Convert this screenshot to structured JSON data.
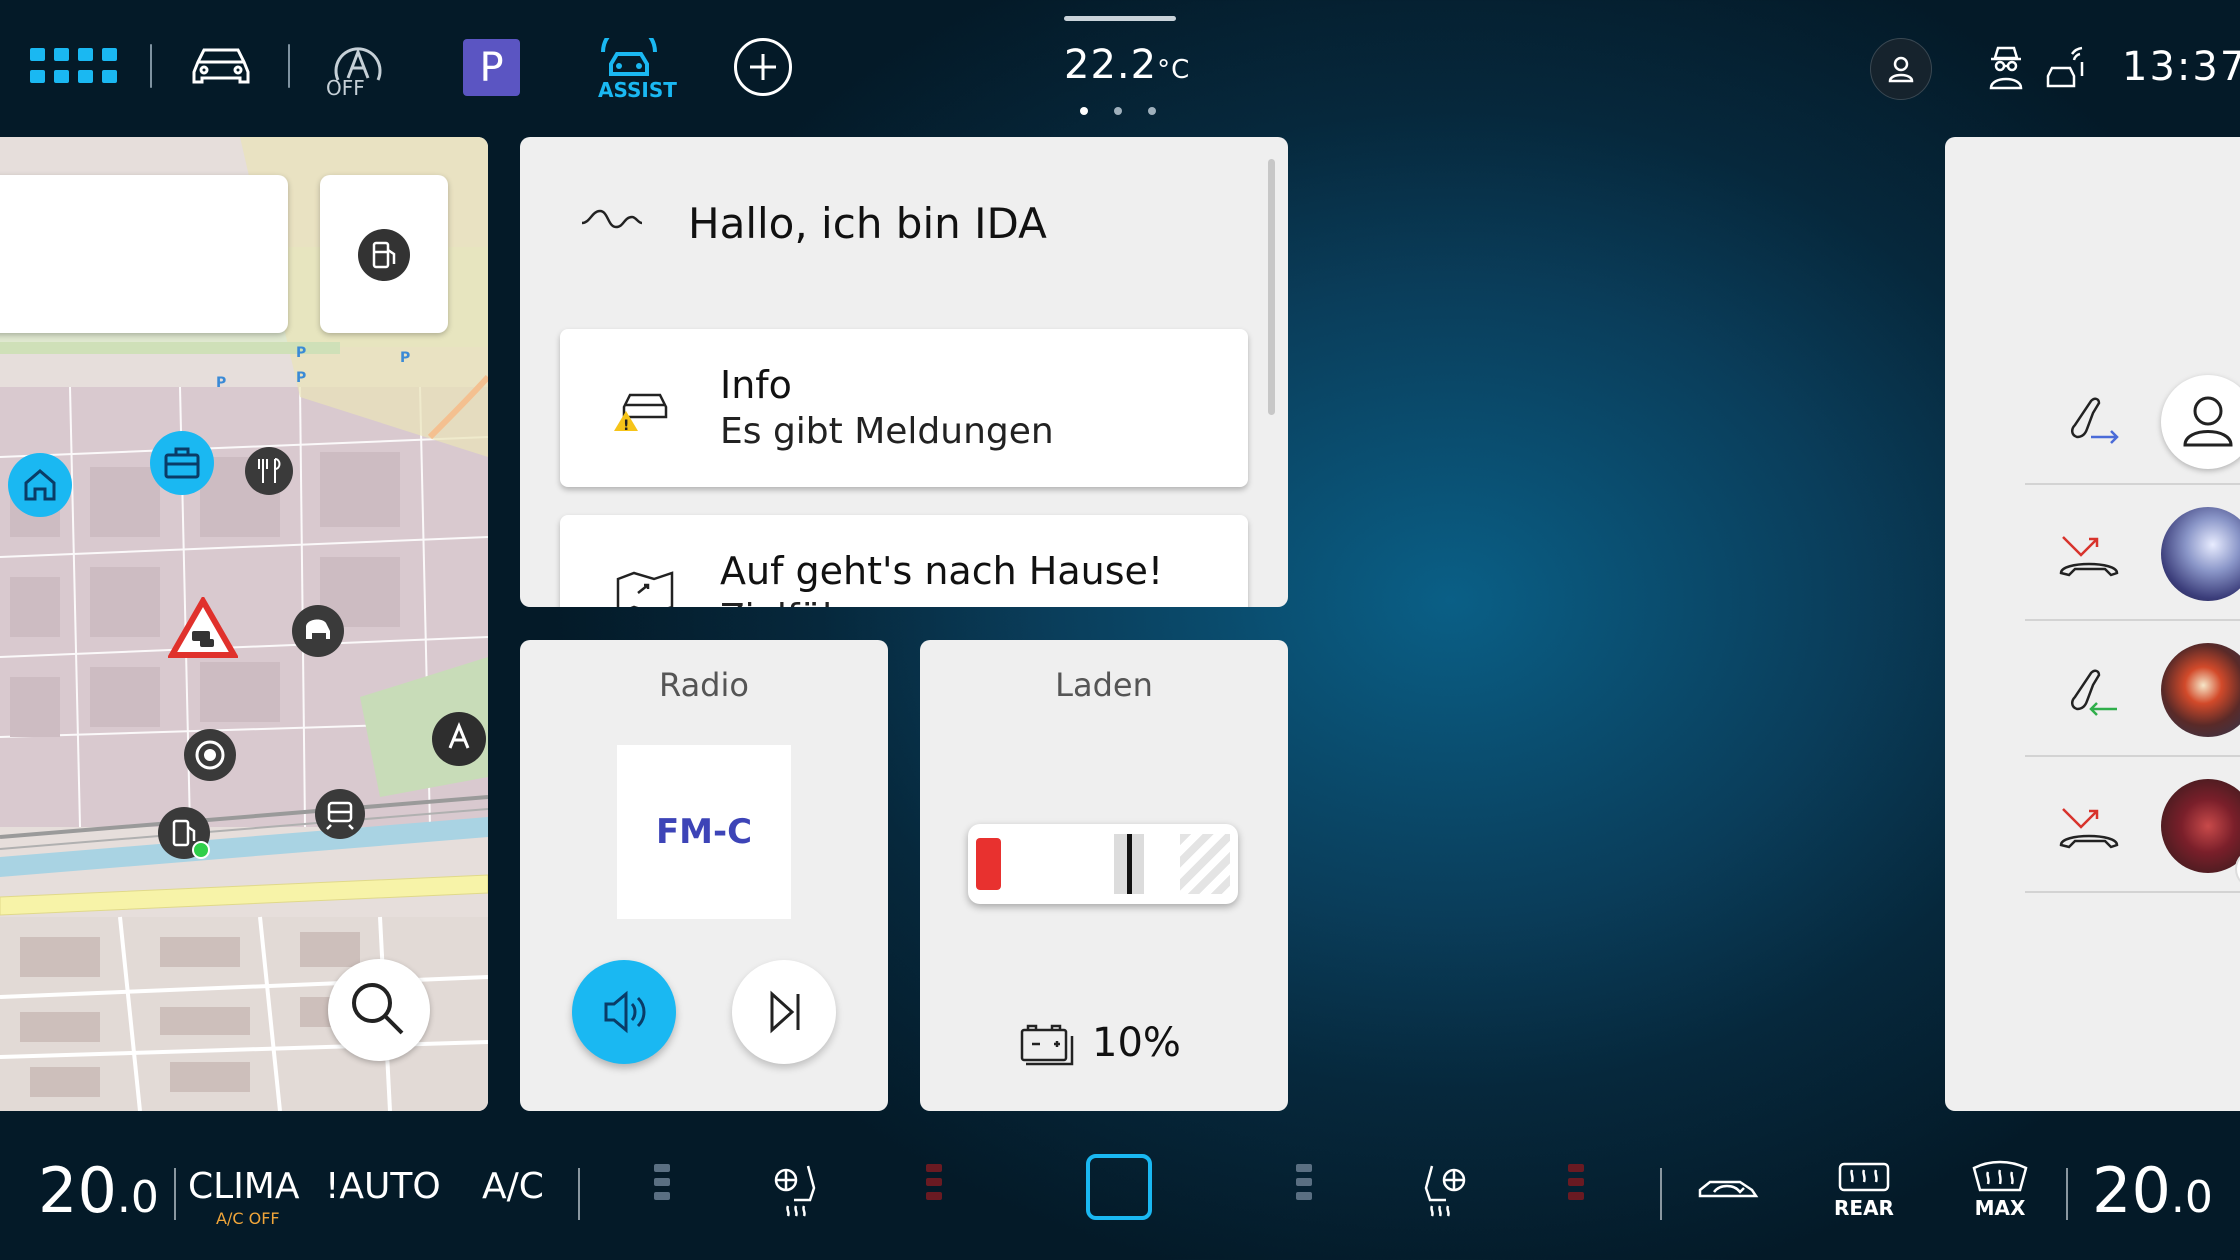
{
  "top_bar": {
    "assist_off_label": "OFF",
    "park_label": "P",
    "assist_label": "ASSIST",
    "temperature_value": "22.2",
    "temperature_unit": "°C",
    "page_count": 3,
    "active_page": 1,
    "clock": "13:37"
  },
  "ida": {
    "title": "Hallo, ich bin IDA",
    "items": [
      {
        "title": "Info",
        "subtitle": "Es gibt Meldungen",
        "icon": "car-warning-icon"
      },
      {
        "title": "Auf geht's nach Hause!",
        "subtitle": "Zielführung",
        "icon": "route-map-icon"
      }
    ]
  },
  "radio": {
    "title": "Radio",
    "station": "FM-C"
  },
  "charging": {
    "title": "Laden",
    "battery_percent": "10%",
    "battery_level": 0.1
  },
  "calls": {
    "entries": [
      {
        "type": "outgoing",
        "icon": "outgoing-call-icon",
        "contact": "no-photo"
      },
      {
        "type": "missed",
        "icon": "missed-call-icon",
        "contact": "photo"
      },
      {
        "type": "incoming",
        "icon": "incoming-call-icon",
        "contact": "photo"
      },
      {
        "type": "missed",
        "icon": "missed-call-icon",
        "contact": "photo"
      }
    ]
  },
  "climate": {
    "left_temp_main": "20",
    "left_temp_decimal": ".0",
    "clima_label": "CLIMA",
    "ac_off_label": "A/C OFF",
    "auto_label": "!AUTO",
    "ac_label": "A/C",
    "rear_label": "REAR",
    "max_label": "MAX",
    "right_temp_main": "20",
    "right_temp_decimal": ".0"
  },
  "colors": {
    "accent_blue": "#1ab8f2",
    "park_purple": "#5b55c2",
    "battery_red": "#e8312f",
    "missed_red": "#d8332c",
    "incoming_green": "#2fae4a",
    "outgoing_blue": "#4a6bd8"
  }
}
